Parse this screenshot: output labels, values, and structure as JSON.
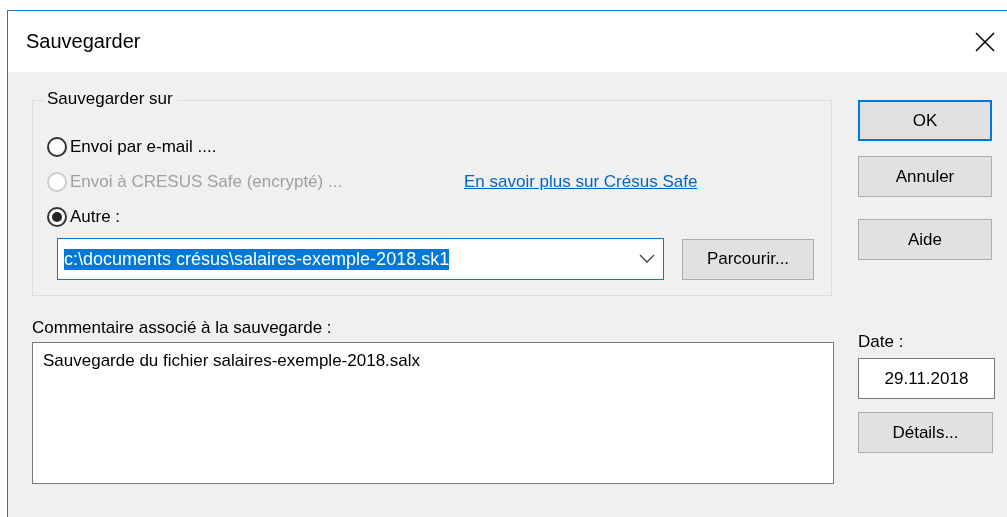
{
  "window": {
    "title": "Sauvegarder"
  },
  "destination": {
    "legend": "Sauvegarder sur",
    "options": [
      {
        "label": "Envoi par e-mail ....",
        "selected": false,
        "disabled": false
      },
      {
        "label": "Envoi à CRESUS Safe (encrypté) ...",
        "selected": false,
        "disabled": true
      },
      {
        "label": "Autre :",
        "selected": true,
        "disabled": false
      }
    ],
    "link": "En savoir plus sur Crésus Safe",
    "path": {
      "value": "c:\\documents crésus\\salaires-exemple-2018.sk1",
      "highlighted": true
    },
    "browse_button": "Parcourir..."
  },
  "comment": {
    "label": "Commentaire associé à la sauvegarde :",
    "value": "Sauvegarde du fichier salaires-exemple-2018.salx"
  },
  "date": {
    "label": "Date :",
    "value": "29.11.2018"
  },
  "details_button": "Détails...",
  "buttons": [
    {
      "label": "OK",
      "default": true
    },
    {
      "label": "Annuler",
      "default": false
    },
    {
      "label": "Aide",
      "default": false
    }
  ]
}
